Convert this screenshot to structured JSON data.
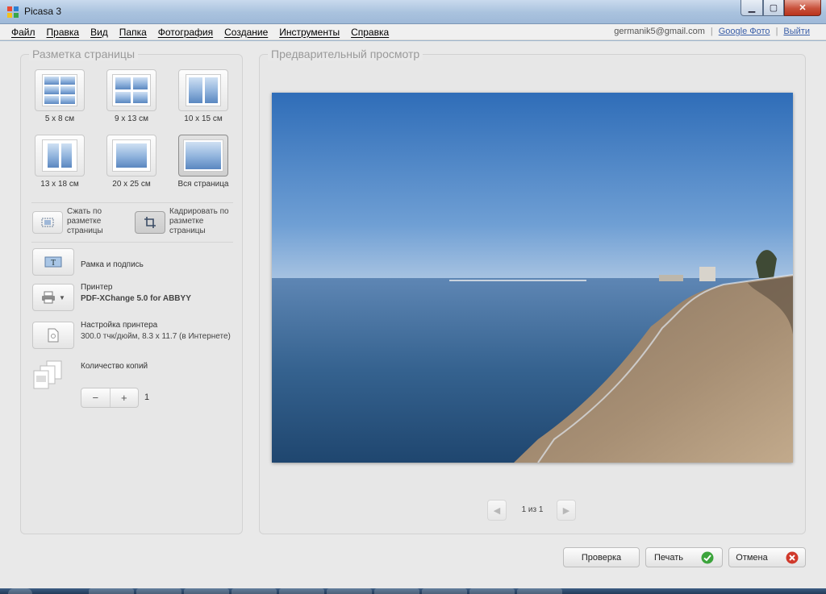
{
  "window": {
    "title": "Picasa 3"
  },
  "menu": [
    "Файл",
    "Правка",
    "Вид",
    "Папка",
    "Фотография",
    "Создание",
    "Инструменты",
    "Справка"
  ],
  "account": {
    "email": "germanik5@gmail.com",
    "google_photo": "Google Фото",
    "logout": "Выйти"
  },
  "layout_panel": {
    "title": "Разметка страницы",
    "layouts": [
      {
        "label": "5 x 8 см",
        "icon": "layout-5x8-icon",
        "selected": false
      },
      {
        "label": "9 x 13 см",
        "icon": "layout-9x13-icon",
        "selected": false
      },
      {
        "label": "10 x 15 см",
        "icon": "layout-10x15-icon",
        "selected": false
      },
      {
        "label": "13 x 18 см",
        "icon": "layout-13x18-icon",
        "selected": false
      },
      {
        "label": "20 x 25 см",
        "icon": "layout-20x25-icon",
        "selected": false
      },
      {
        "label": "Вся страница",
        "icon": "layout-full-page-icon",
        "selected": true
      }
    ],
    "shrink_label": "Сжать по разметке страницы",
    "crop_label": "Кадрировать по разметке страницы",
    "border_caption": "Рамка и подпись",
    "printer_label": "Принтер",
    "printer_value": "PDF-XChange 5.0 for ABBYY",
    "printer_settings_label": "Настройка принтера",
    "printer_settings_value": "300.0 тчк/дюйм, 8.3 x 11.7 (в Интернете)",
    "copies_label": "Количество копий",
    "minus": "−",
    "plus": "+",
    "copies_value": "1"
  },
  "preview_panel": {
    "title": "Предварительный просмотр",
    "page_indicator": "1 из 1"
  },
  "footer": {
    "review": "Проверка",
    "print": "Печать",
    "cancel": "Отмена"
  },
  "colors": {
    "accent_green": "#3ca43c",
    "cancel_red": "#d0392b"
  }
}
